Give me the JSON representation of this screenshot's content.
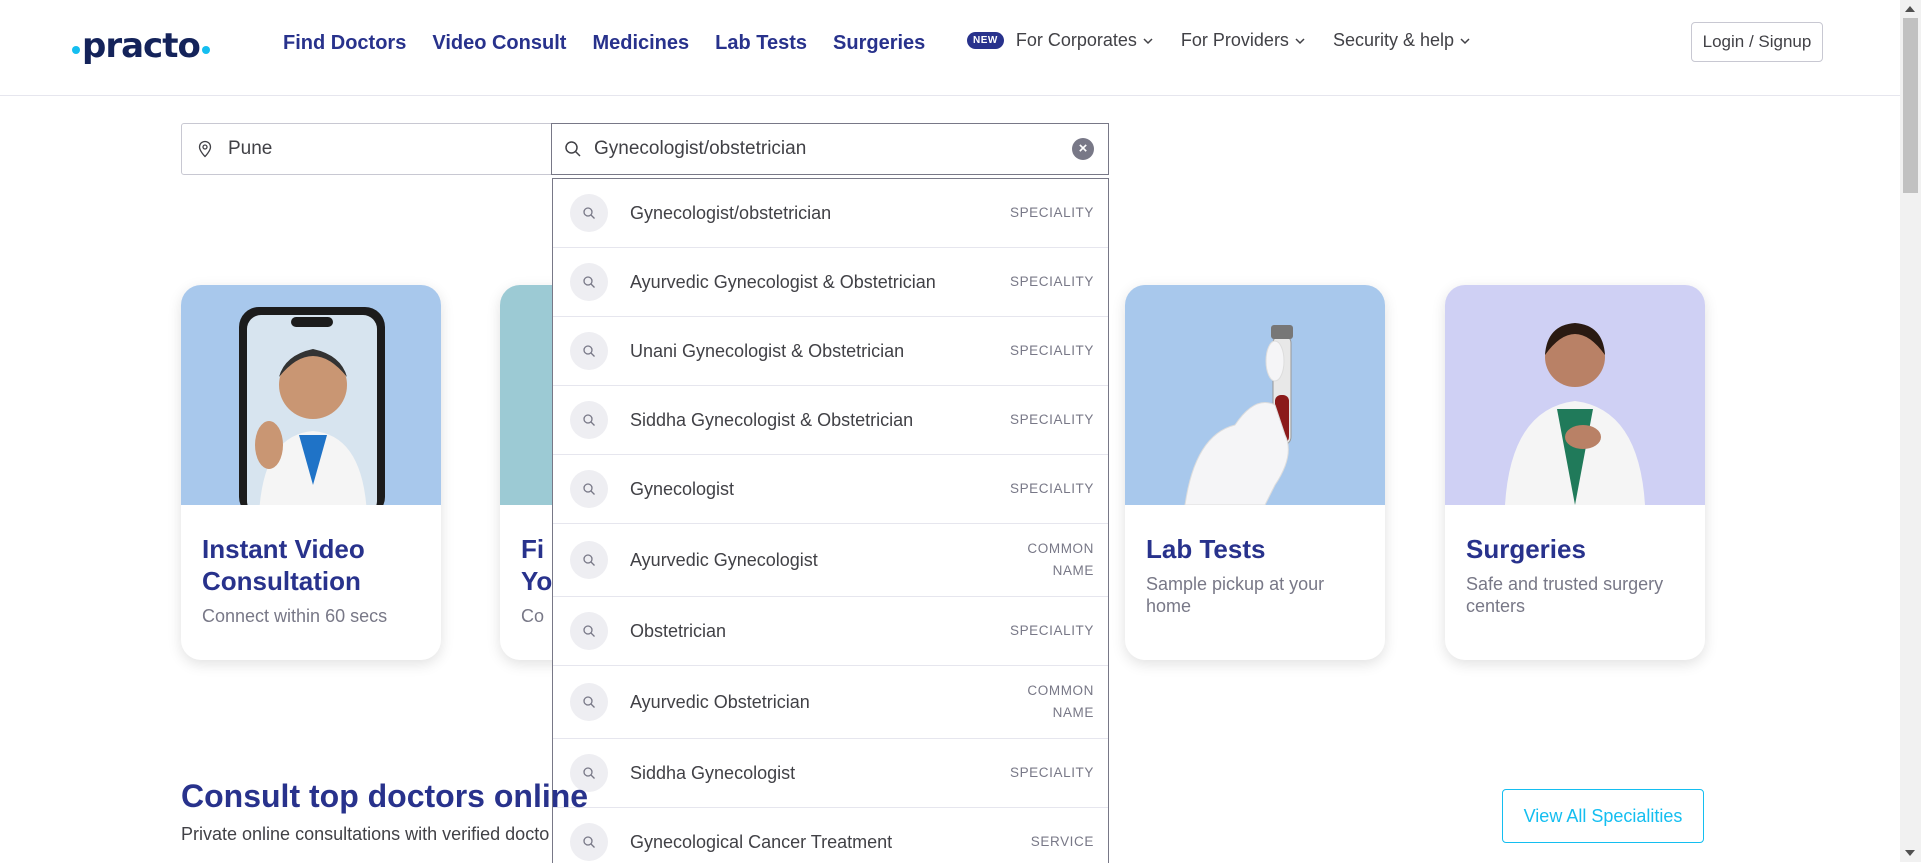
{
  "brand": {
    "name": "practo",
    "accent": "#14bef0",
    "primary": "#28328c"
  },
  "nav": {
    "links": [
      "Find Doctors",
      "Video Consult",
      "Medicines",
      "Lab Tests",
      "Surgeries"
    ],
    "new_badge": "NEW",
    "corporates": "For Corporates",
    "providers": "For Providers",
    "security": "Security & help",
    "login": "Login / Signup"
  },
  "search": {
    "location_value": "Pune",
    "query_value": "Gynecologist/obstetrician",
    "clear_icon": "close-icon"
  },
  "cards": [
    {
      "title": "Instant Video Consultation",
      "sub": "Connect within 60 secs",
      "bg": "#a8c8ec"
    },
    {
      "title": "Find Doctors Near You",
      "title_visible": "Fi\nYo",
      "sub": "Co",
      "bg": "#9ccad4"
    },
    {
      "title": "Lab Tests",
      "sub": "Sample pickup at your home",
      "bg": "#a8c8ec"
    },
    {
      "title": "Surgeries",
      "sub": "Safe and trusted surgery centers",
      "bg": "#cfd0f4"
    }
  ],
  "suggestions": [
    {
      "label": "Gynecologist/obstetrician",
      "type": "SPECIALITY"
    },
    {
      "label": "Ayurvedic Gynecologist & Obstetrician",
      "type": "SPECIALITY"
    },
    {
      "label": "Unani Gynecologist & Obstetrician",
      "type": "SPECIALITY"
    },
    {
      "label": "Siddha Gynecologist & Obstetrician",
      "type": "SPECIALITY"
    },
    {
      "label": "Gynecologist",
      "type": "SPECIALITY"
    },
    {
      "label": "Ayurvedic Gynecologist",
      "type": "COMMON NAME"
    },
    {
      "label": "Obstetrician",
      "type": "SPECIALITY"
    },
    {
      "label": "Ayurvedic Obstetrician",
      "type": "COMMON NAME"
    },
    {
      "label": "Siddha Gynecologist",
      "type": "SPECIALITY"
    },
    {
      "label": "Gynecological Cancer Treatment",
      "type": "SERVICE"
    }
  ],
  "consult": {
    "title": "Consult top doctors online",
    "sub": "Private online consultations with verified docto",
    "view_all": "View All Specialities"
  }
}
